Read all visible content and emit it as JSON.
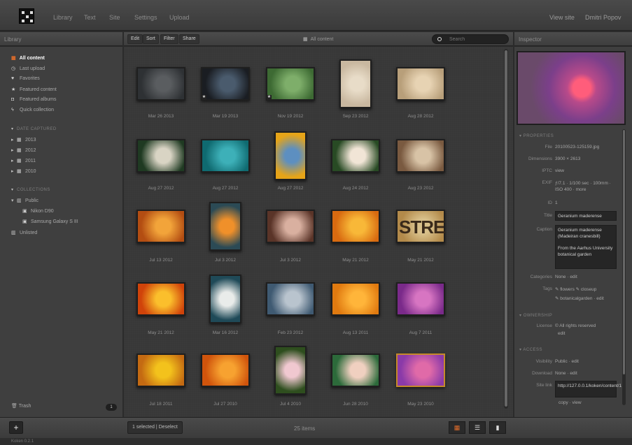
{
  "nav": {
    "items": [
      "Library",
      "Text",
      "Site",
      "Settings",
      "Upload"
    ],
    "right": [
      "View site",
      "Dmitri Popov"
    ]
  },
  "library_panel": {
    "title": "Library",
    "main_items": [
      {
        "icon": "library-icon",
        "label": "All content",
        "selected": true
      },
      {
        "icon": "clock-icon",
        "label": "Last upload"
      },
      {
        "icon": "heart-icon",
        "label": "Favorites"
      },
      {
        "icon": "star-icon",
        "label": "Featured content"
      },
      {
        "icon": "album-icon",
        "label": "Featured albums"
      },
      {
        "icon": "bolt-icon",
        "label": "Quick collection"
      }
    ],
    "date_section": "DATE CAPTURED",
    "years": [
      "2013",
      "2012",
      "2011",
      "2010"
    ],
    "collections_section": "COLLECTIONS",
    "collections": [
      {
        "label": "Public",
        "expanded": true,
        "children": [
          "Nikon D90",
          "Samsung Galaxy S III"
        ]
      },
      {
        "label": "Unlisted"
      }
    ],
    "trash": {
      "label": "Trash",
      "count": "1"
    }
  },
  "toolbar": {
    "buttons": [
      "Edit",
      "Sort",
      "Filter",
      "Share"
    ],
    "title": "All content",
    "search_placeholder": "Search"
  },
  "grid": {
    "items": [
      {
        "date": "Mar 26 2013",
        "c1": "#2e3134",
        "c2": "#5a5d60",
        "w": 70,
        "h": 48
      },
      {
        "date": "Mar 19 2013",
        "c1": "#1a1d22",
        "c2": "#4a5b6d",
        "w": 70,
        "h": 48,
        "star": true
      },
      {
        "date": "Nov 19 2012",
        "c1": "#3d6a33",
        "c2": "#7eae6a",
        "w": 70,
        "h": 48,
        "star": true
      },
      {
        "date": "Sep 23 2012",
        "c1": "#c9b8a0",
        "c2": "#e8dcc8",
        "w": 46,
        "h": 70
      },
      {
        "date": "Aug 28 2012",
        "c1": "#b89f7a",
        "c2": "#e7d3b3",
        "w": 70,
        "h": 48
      },
      {
        "date": "Aug 27 2012",
        "c1": "#1f3a22",
        "c2": "#d9d4c4",
        "w": 70,
        "h": 48
      },
      {
        "date": "Aug 27 2012",
        "c1": "#0f6a70",
        "c2": "#3db0b8",
        "w": 70,
        "h": 48
      },
      {
        "date": "Aug 27 2012",
        "c1": "#e6a418",
        "c2": "#5d8fc0",
        "w": 46,
        "h": 70
      },
      {
        "date": "Aug 24 2012",
        "c1": "#284a24",
        "c2": "#f1e5d6",
        "w": 70,
        "h": 48
      },
      {
        "date": "Aug 23 2012",
        "c1": "#7a5a40",
        "c2": "#d8c3a6",
        "w": 70,
        "h": 48
      },
      {
        "date": "Jul 13 2012",
        "c1": "#b34d12",
        "c2": "#f2a43a",
        "w": 70,
        "h": 48
      },
      {
        "date": "Jul 3 2012",
        "c1": "#2b4a55",
        "c2": "#f0902a",
        "w": 46,
        "h": 70
      },
      {
        "date": "Jul 3 2012",
        "c1": "#5a3428",
        "c2": "#d9b0a0",
        "w": 70,
        "h": 48
      },
      {
        "date": "May 21 2012",
        "c1": "#d86a10",
        "c2": "#f8b838",
        "w": 70,
        "h": 48
      },
      {
        "date": "May 21 2012",
        "c1": "#b38a4a",
        "c2": "#d8c08a",
        "w": 70,
        "h": 48,
        "text": "STRE"
      },
      {
        "date": "May 21 2012",
        "c1": "#d0430a",
        "c2": "#fbbf2c",
        "w": 70,
        "h": 48
      },
      {
        "date": "Mar 16 2012",
        "c1": "#1f4a58",
        "c2": "#e9ecea",
        "w": 46,
        "h": 70
      },
      {
        "date": "Feb 23 2012",
        "c1": "#3f5a72",
        "c2": "#b9c4ce",
        "w": 70,
        "h": 48
      },
      {
        "date": "Aug 13 2011",
        "c1": "#e07a10",
        "c2": "#ffb53a",
        "w": 70,
        "h": 48
      },
      {
        "date": "Aug 7 2011",
        "c1": "#7a2a8a",
        "c2": "#d775c2",
        "w": 70,
        "h": 48
      },
      {
        "date": "Jul 18 2011",
        "c1": "#c46a12",
        "c2": "#f3c21c",
        "w": 70,
        "h": 48
      },
      {
        "date": "Jul 27 2010",
        "c1": "#d0540c",
        "c2": "#f7a230",
        "w": 70,
        "h": 48
      },
      {
        "date": "Jul 4 2010",
        "c1": "#2e4e1e",
        "c2": "#f0c8d0",
        "w": 46,
        "h": 70
      },
      {
        "date": "Jun 28 2010",
        "c1": "#2c6a3a",
        "c2": "#f0d0c0",
        "w": 70,
        "h": 48
      },
      {
        "date": "May 23 2010",
        "c1": "#8a3aa8",
        "c2": "#e06aa8",
        "w": 70,
        "h": 48,
        "highlight": true
      }
    ]
  },
  "inspector": {
    "title": "Inspector",
    "properties_section": "PROPERTIES",
    "file_label": "File",
    "file": "20100523-125159.jpg",
    "dimensions_label": "Dimensions",
    "dimensions": "3900 × 2613",
    "iptc_label": "IPTC",
    "iptc": "view",
    "exif_label": "EXIF",
    "exif": "ƒ/7.1 · 1/100 sec · 100mm · ISO 400 · more",
    "id_label": "ID",
    "id": "1",
    "title_label": "Title",
    "title_value": "Geranium maderense",
    "caption_label": "Caption",
    "caption_1": "Geranium maderense (Madeiran cranesbill)",
    "caption_2": "From the Aarhus University botanical garden",
    "categories_label": "Categories",
    "categories": "None · edit",
    "tags_label": "Tags",
    "tags": "✎ flowers ✎ closeup",
    "tags_2": "✎ botanicalgarden · edit",
    "ownership_section": "OWNERSHIP",
    "license_label": "License",
    "license": "© All rights reserved",
    "license_edit": "edit",
    "access_section": "ACCESS",
    "visibility_label": "Visibility",
    "visibility": "Public · edit",
    "download_label": "Download",
    "download": "None · edit",
    "sitelink_label": "Site link",
    "sitelink": "http://127.0.0.1/koken/content/1",
    "sitelink_actions": "copy · view"
  },
  "bottom": {
    "add": "+",
    "selection": "1 selected | Deselect",
    "count": "25 items",
    "version": "Koken 0.2.1"
  },
  "colors": {
    "accent": "#e06c2a",
    "highlight": "#c68a2a"
  }
}
